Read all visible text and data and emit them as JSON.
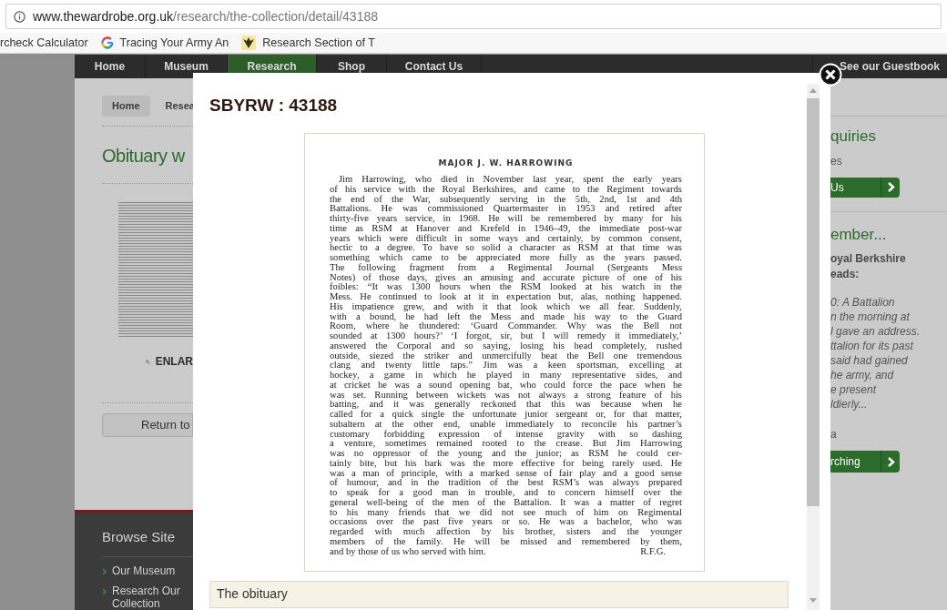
{
  "browser": {
    "url_host": "www.thewardrobe.org.uk",
    "url_path": "/research/the-collection/detail/43188",
    "bookmarks": [
      {
        "kind": "page",
        "label": "rcheck Calculator"
      },
      {
        "kind": "google",
        "label": "Tracing Your Army An"
      },
      {
        "kind": "crest",
        "label": "Research Section of T"
      }
    ]
  },
  "nav": {
    "items": [
      {
        "label": "Home",
        "selected": false
      },
      {
        "label": "Museum",
        "selected": false
      },
      {
        "label": "Research",
        "selected": true
      },
      {
        "label": "Shop",
        "selected": false
      },
      {
        "label": "Contact Us",
        "selected": false
      }
    ],
    "guestbook": "See our Guestbook"
  },
  "breadcrumb": [
    "Home",
    "Resea"
  ],
  "page": {
    "heading": "Obituary w",
    "enlarge": "ENLAR",
    "return_button": "Return to"
  },
  "footer": {
    "title": "Browse Site",
    "links": [
      "Our Museum",
      "Research Our Collection"
    ]
  },
  "sidebar": {
    "enquiries": {
      "heading": "quiries",
      "text": "es",
      "button": "Us"
    },
    "remember": {
      "heading": "ember...",
      "bold_lines": [
        "oyal Berkshire",
        "eads:"
      ],
      "italic_lines": [
        "0: A Battalion",
        "n the morning at",
        "l gave an address.",
        "ttalion for its past",
        "said had gained",
        "he army, and",
        "e present",
        "ldierly..."
      ],
      "note": "a",
      "button": "rching"
    }
  },
  "modal": {
    "title": "SBYRW : 43188",
    "document": {
      "heading": "MAJOR J. W. HARROWING",
      "lines": [
        "Jim Harrowing, who died in November last year, spent the early years",
        "of his service with the Royal Berkshires, and came to the Regiment towards",
        "the end of the War, subsequently serving in the 5th, 2nd, 1st and 4th",
        "Battalions. He was commissioned Quartermaster in 1953 and retired after",
        "thirty-five years service, in 1968. He will be remembered by many for his",
        "time as RSM at Hanover and Krefeld in 1946–49, the immediate post-war",
        "years which were difficult in some ways and certainly, by common consent,",
        "hectic to a degree. To have so solid a character as RSM at that time was",
        "something which came to be appreciated more fully as the years passed.",
        "The following fragment from a Regimental Journal (Sergeants Mess",
        "Notes) of those days, gives an amusing and accurate picture of one of his",
        "foibles: “It was 1300 hours when the RSM looked at his watch in the",
        "Mess. He continued to look at it in expectation but, alas, nothing happened.",
        "His impatience grew, and with it that look which we all fear. Suddenly,",
        "with a bound, he had left the Mess and made his way to the Guard",
        "Room, where he thundered: ‘Guard Commander. Why was the Bell not",
        "sounded at 1300 hours?’ ‘I forgot, sir, but I will remedy it immediately,’",
        "answered the Corporal and so saying, losing his head completely, rushed",
        "outside, siezed the striker and unmercifully beat the Bell one tremendous",
        "clang and twenty little taps.” Jim was a keen sportsman, excelling at",
        "hockey, a game in which he played in many representative sides, and",
        "at cricket he was a sound opening bat, who could force the pace when he",
        "was set. Running between wickets was not always a strong feature of his",
        "batting, and it was generally reckoned that this was because when he",
        "called for a quick single the unfortunate junior sergeant or, for that matter,",
        "subaltern at the other end, unable immediately to reconcile his partner’s",
        "customary forbidding expression of intense gravity with so dashing",
        "a venture, sometimes remained rooted to the crease. But Jim Harrowing",
        "was no oppressor of the young and the junior; as RSM he could cer-",
        "tainly bite, but his bark was the more effective for being rarely used. He",
        "was a man of principle, with a marked sense of fair play and a good sense",
        "of humour, and in the tradition of the best RSM’s was always prepared",
        "to speak for a good man in trouble, and to concern himself over the",
        "general well-being of the men of the Battalion. It was a matter of regret",
        "to his many friends that we did not see much of him on Regimental",
        "occasions over the past five years or so. He was a bachelor, who was",
        "regarded with much affection by his brother, sisters and the younger",
        "members of the family. He will be missed and remembered by them,"
      ],
      "last_line": "and by those of us who served with him.",
      "signature": "R.F.G."
    },
    "caption": "The obituary"
  }
}
